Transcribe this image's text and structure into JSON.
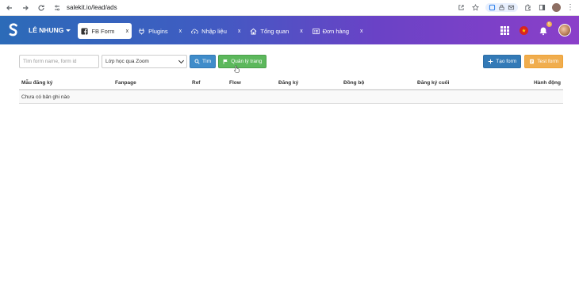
{
  "browser": {
    "url": "salekit.io/lead/ads"
  },
  "header": {
    "user_name": "LÊ NHUNG",
    "notifications_count": "5",
    "tabs": [
      {
        "label": "FB Form",
        "icon": "facebook-icon",
        "active": true,
        "close": "x"
      },
      {
        "label": "Plugins",
        "icon": "plug-icon",
        "active": false,
        "close": "x"
      },
      {
        "label": "Nhập liệu",
        "icon": "cloud-upload-icon",
        "active": false,
        "close": "x"
      },
      {
        "label": "Tổng quan",
        "icon": "home-icon",
        "active": false,
        "close": "x"
      },
      {
        "label": "Đơn hàng",
        "icon": "list-icon",
        "active": false,
        "close": "x"
      }
    ]
  },
  "toolbar": {
    "search_placeholder": "Tìm form name, form id",
    "select_value": "Lớp học qua Zoom",
    "search_button": "Tìm",
    "manage_button": "Quản lý trang",
    "create_button": "Tạo form",
    "test_button": "Test form"
  },
  "table": {
    "columns": [
      "Mẫu đăng ký",
      "Fanpage",
      "Ref",
      "Flow",
      "Đăng ký",
      "Đồng bộ",
      "Đăng ký cuối",
      "Hành động"
    ],
    "empty_message": "Chưa có bản ghi nào"
  },
  "colors": {
    "primary": "#337ab7",
    "success": "#5cb85c",
    "warning": "#f0ad4e",
    "header_gradient_start": "#2c6bb8",
    "header_gradient_end": "#8b3fc9"
  }
}
